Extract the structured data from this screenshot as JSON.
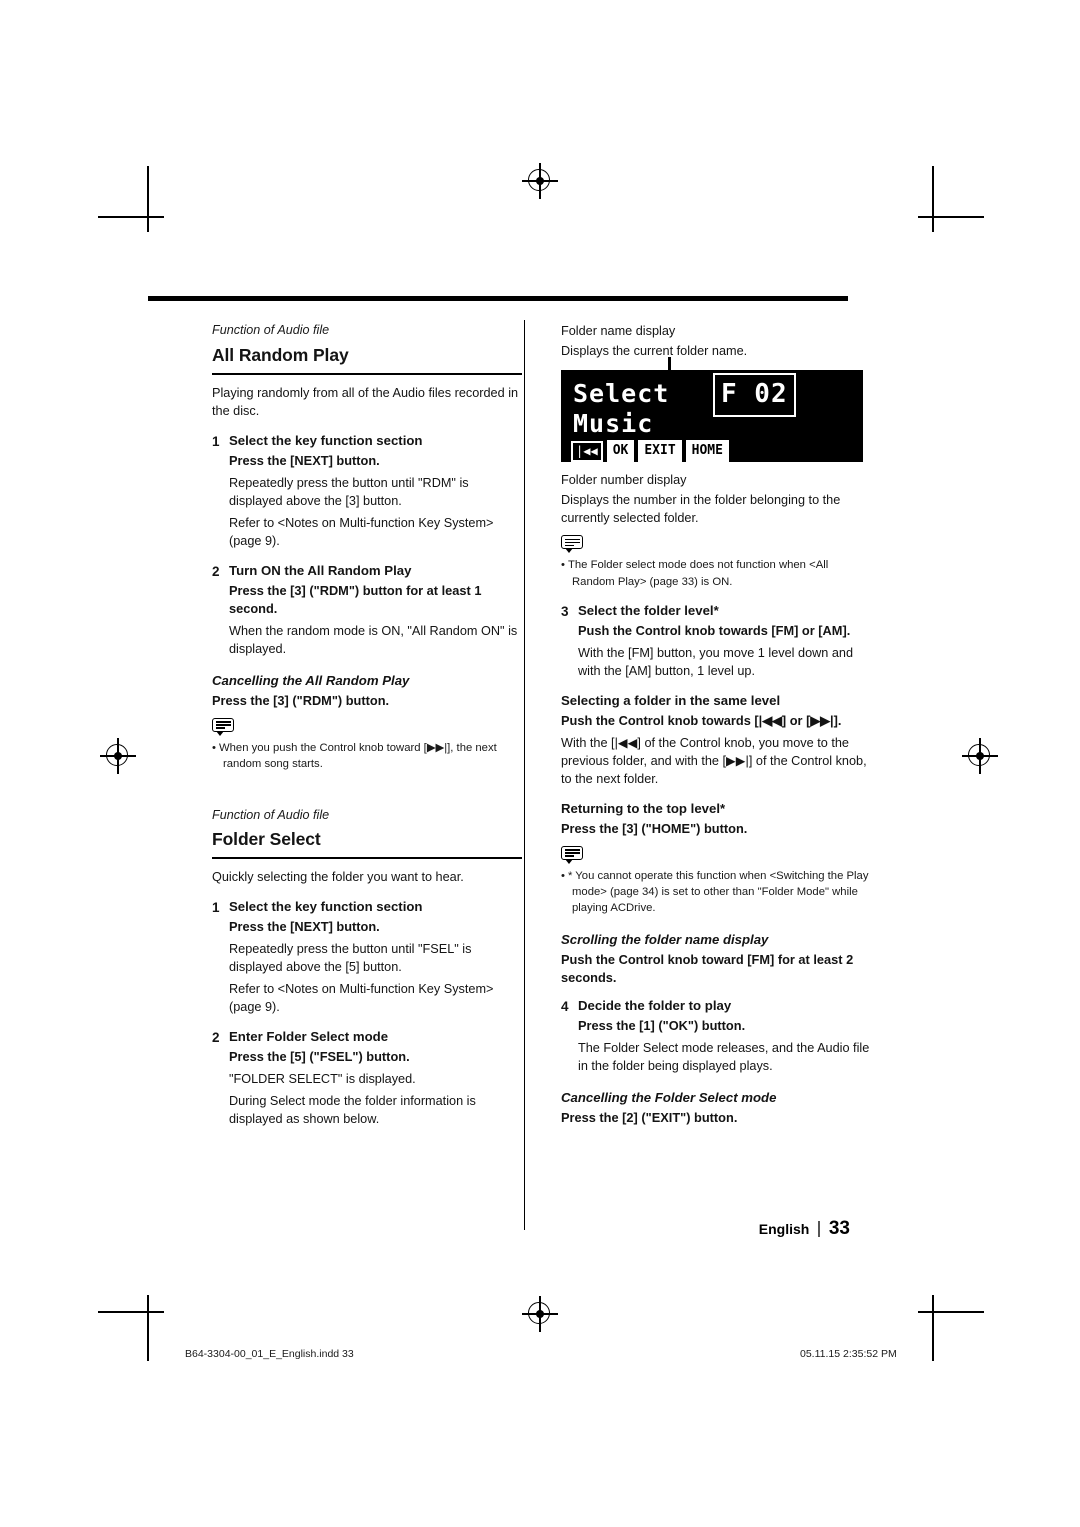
{
  "document": {
    "page_number": "33",
    "language_label": "English",
    "imprint_left": "B64-3304-00_01_E_English.indd   33",
    "imprint_right": "05.11.15   2:35:52 PM"
  },
  "left_column": {
    "section1": {
      "function_label": "Function of Audio file",
      "title": "All Random Play",
      "intro": "Playing randomly from all of the Audio files recorded in the disc.",
      "step1": {
        "num": "1",
        "title": "Select the key function section",
        "sub": "Press the [NEXT] button.",
        "text": "Repeatedly press the button until \"RDM\" is displayed above the [3] button.",
        "text2": "Refer to <Notes on Multi-function Key System> (page 9)."
      },
      "step2": {
        "num": "2",
        "title": "Turn ON the All Random Play",
        "sub": "Press the [3] (\"RDM\") button for at least 1 second.",
        "text": "When the random mode is ON, \"All Random ON\" is displayed."
      },
      "cancel_heading": "Cancelling the All Random Play",
      "cancel_sub": "Press the [3] (\"RDM\") button.",
      "note_bullet": "When you push the Control knob toward [▶▶|], the next random song starts."
    },
    "section2": {
      "function_label": "Function of Audio file",
      "title": "Folder Select",
      "intro": "Quickly selecting the folder you want to hear.",
      "step1": {
        "num": "1",
        "title": "Select the key function section",
        "sub": "Press the [NEXT] button.",
        "text": "Repeatedly press the button until \"FSEL\" is displayed above the [5] button.",
        "text2": "Refer to <Notes on Multi-function Key System> (page 9)."
      },
      "step2": {
        "num": "2",
        "title": "Enter Folder Select mode",
        "sub": "Press the [5] (\"FSEL\") button.",
        "text": "\"FOLDER SELECT\" is displayed.",
        "text2": "During Select mode the folder information is displayed as shown below."
      }
    }
  },
  "right_column": {
    "folder_name_label": "Folder name display",
    "folder_name_desc": "Displays the current folder name.",
    "lcd": {
      "line1_left": "Select",
      "line1_right": "F 02",
      "line2": "Music",
      "btn_prev": "|◀◀",
      "btn_ok": "OK",
      "btn_exit": "EXIT",
      "btn_home": "HOME"
    },
    "folder_number_label": "Folder number display",
    "folder_number_desc": "Displays the number in the folder belonging to the currently selected folder.",
    "note1_bullet": "The Folder select mode does not function when <All Random Play> (page 33) is ON.",
    "step3": {
      "num": "3",
      "title": "Select the folder level*",
      "sub": "Push the Control knob towards [FM] or [AM].",
      "text": "With the [FM] button, you move 1 level down and with the [AM] button, 1 level up."
    },
    "same_level_head": "Selecting a folder in the same level",
    "same_level_sub": "Push the Control knob towards [|◀◀] or [▶▶|].",
    "same_level_text": "With the [|◀◀] of the Control knob, you move to the previous folder, and with the [▶▶|] of the Control knob, to the next folder.",
    "top_level_head": "Returning to the top level*",
    "top_level_sub": "Press the [3] (\"HOME\") button.",
    "note2_bullet": "* You cannot operate this function when <Switching the Play mode> (page 34) is set to other than \"Folder Mode\" while playing ACDrive.",
    "scroll_head": "Scrolling the folder name display",
    "scroll_sub": "Push the Control knob toward [FM] for at least 2 seconds.",
    "step4": {
      "num": "4",
      "title": "Decide the folder to play",
      "sub": "Press the [1] (\"OK\") button.",
      "text": "The Folder Select mode releases, and the Audio file in the folder being displayed plays."
    },
    "cancel_head": "Cancelling the Folder Select mode",
    "cancel_sub": "Press the [2] (\"EXIT\") button."
  }
}
